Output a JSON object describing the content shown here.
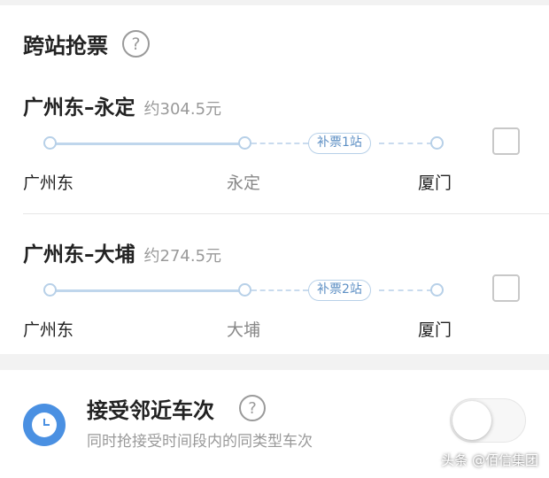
{
  "section": {
    "title": "跨站抢票",
    "help_icon": "?"
  },
  "routes": [
    {
      "name": "广州东–永定",
      "price": "约304.5元",
      "from": "广州东",
      "mid": "永定",
      "to": "厦门",
      "extra": "补票1站",
      "checked": false
    },
    {
      "name": "广州东–大埔",
      "price": "约274.5元",
      "from": "广州东",
      "mid": "大埔",
      "to": "厦门",
      "extra": "补票2站",
      "checked": false
    }
  ],
  "nearby": {
    "title": "接受邻近车次",
    "subtitle": "同时抢接受时间段内的同类型车次",
    "help_icon": "?",
    "enabled": false
  },
  "watermark": "头条 @佰信集团",
  "colors": {
    "accent": "#4a90e2",
    "track": "#bfd6ec",
    "pill_text": "#5d8fc4"
  }
}
